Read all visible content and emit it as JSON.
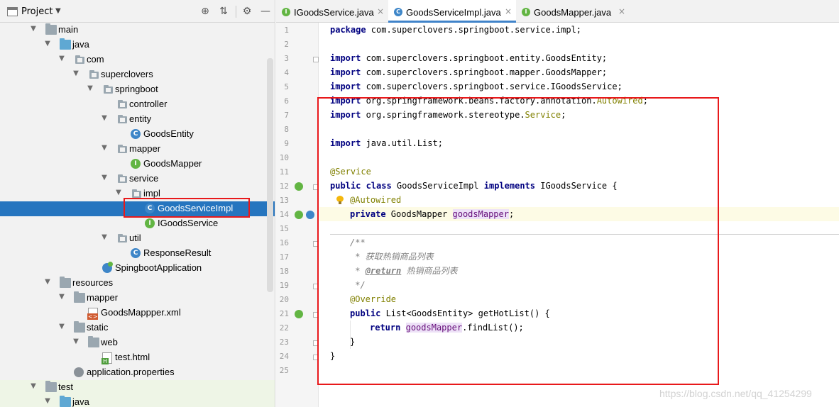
{
  "project_panel": {
    "title": "Project",
    "dropdown": "▼",
    "actions": [
      "⊕",
      "⇅",
      "⚙",
      "—"
    ]
  },
  "tree": [
    {
      "label": "main",
      "icon": "folder",
      "arrow": "▼"
    },
    {
      "label": "java",
      "icon": "source-folder",
      "arrow": "▼"
    },
    {
      "label": "com",
      "icon": "package",
      "arrow": "▼"
    },
    {
      "label": "superclovers",
      "icon": "package",
      "arrow": "▼"
    },
    {
      "label": "springboot",
      "icon": "package",
      "arrow": "▼"
    },
    {
      "label": "controller",
      "icon": "package",
      "arrow": ""
    },
    {
      "label": "entity",
      "icon": "package",
      "arrow": "▼"
    },
    {
      "label": "GoodsEntity",
      "icon": "class",
      "arrow": ""
    },
    {
      "label": "mapper",
      "icon": "package",
      "arrow": "▼"
    },
    {
      "label": "GoodsMapper",
      "icon": "interface",
      "arrow": ""
    },
    {
      "label": "service",
      "icon": "package",
      "arrow": "▼"
    },
    {
      "label": "impl",
      "icon": "package",
      "arrow": "▼"
    },
    {
      "label": "GoodsServiceImpl",
      "icon": "class",
      "arrow": "",
      "selected": true
    },
    {
      "label": "IGoodsService",
      "icon": "interface",
      "arrow": ""
    },
    {
      "label": "util",
      "icon": "package",
      "arrow": "▼"
    },
    {
      "label": "ResponseResult",
      "icon": "class",
      "arrow": ""
    },
    {
      "label": "SpingbootApplication",
      "icon": "spring-app",
      "arrow": ""
    },
    {
      "label": "resources",
      "icon": "resources-folder",
      "arrow": "▼"
    },
    {
      "label": "mapper",
      "icon": "folder",
      "arrow": "▼"
    },
    {
      "label": "GoodsMappper.xml",
      "icon": "xml-file",
      "arrow": ""
    },
    {
      "label": "static",
      "icon": "folder",
      "arrow": "▼"
    },
    {
      "label": "web",
      "icon": "folder",
      "arrow": "▼"
    },
    {
      "label": "test.html",
      "icon": "html-file",
      "arrow": ""
    },
    {
      "label": "application.properties",
      "icon": "properties-file",
      "arrow": ""
    },
    {
      "label": "test",
      "icon": "folder",
      "arrow": "▼"
    },
    {
      "label": "java",
      "icon": "test-source-folder",
      "arrow": "▼"
    }
  ],
  "tabs": [
    {
      "label": "IGoodsService.java",
      "icon": "I",
      "icon_color": "#62b543",
      "active": false
    },
    {
      "label": "GoodsServiceImpl.java",
      "icon": "C",
      "icon_color": "#3e86c8",
      "active": true
    },
    {
      "label": "GoodsMapper.java",
      "icon": "I",
      "icon_color": "#62b543",
      "active": false
    }
  ],
  "tab_close": "×",
  "line_numbers": [
    "1",
    "2",
    "3",
    "4",
    "5",
    "6",
    "7",
    "8",
    "9",
    "10",
    "11",
    "12",
    "13",
    "14",
    "15",
    "16",
    "17",
    "18",
    "19",
    "20",
    "21",
    "22",
    "23",
    "24",
    "25"
  ],
  "code": {
    "l1_kw": "package",
    "l1_rest": " com.superclovers.springboot.service.impl;",
    "l3_kw": "import",
    "l3_rest": " com.superclovers.springboot.entity.GoodsEntity;",
    "l4_kw": "import",
    "l4_rest": " com.superclovers.springboot.mapper.GoodsMapper;",
    "l5_kw": "import",
    "l5_rest": " com.superclovers.springboot.service.IGoodsService;",
    "l6_kw": "import",
    "l6_rest": " org.springframework.beans.factory.annotation.",
    "l6_ann": "Autowired",
    "l6_end": ";",
    "l7_kw": "import",
    "l7_rest": " org.springframework.stereotype.",
    "l7_ann": "Service",
    "l7_end": ";",
    "l9_kw": "import",
    "l9_rest": " java.util.List;",
    "l11_ann": "@Service",
    "l12_kw1": "public class",
    "l12_mid": " GoodsServiceImpl ",
    "l12_kw2": "implements",
    "l12_rest": " IGoodsService {",
    "l13_ann": "@Autowired",
    "l14_kw": "private",
    "l14_mid": " GoodsMapper ",
    "l14_fld": "goodsMapper",
    "l14_end": ";",
    "l16": "/**",
    "l17": " * 获取热销商品列表",
    "l18_pre": " * ",
    "l18_tag": "@return",
    "l18_rest": " 热销商品列表",
    "l19": " */",
    "l20_ann": "@Override",
    "l21_kw": "public",
    "l21_rest": " List<GoodsEntity> getHotList() {",
    "l22_kw": "return",
    "l22_fld": "goodsMapper",
    "l22_rest": ".findList();",
    "l23": "}",
    "l24": "}"
  },
  "watermark": "https://blog.csdn.net/qq_41254299"
}
